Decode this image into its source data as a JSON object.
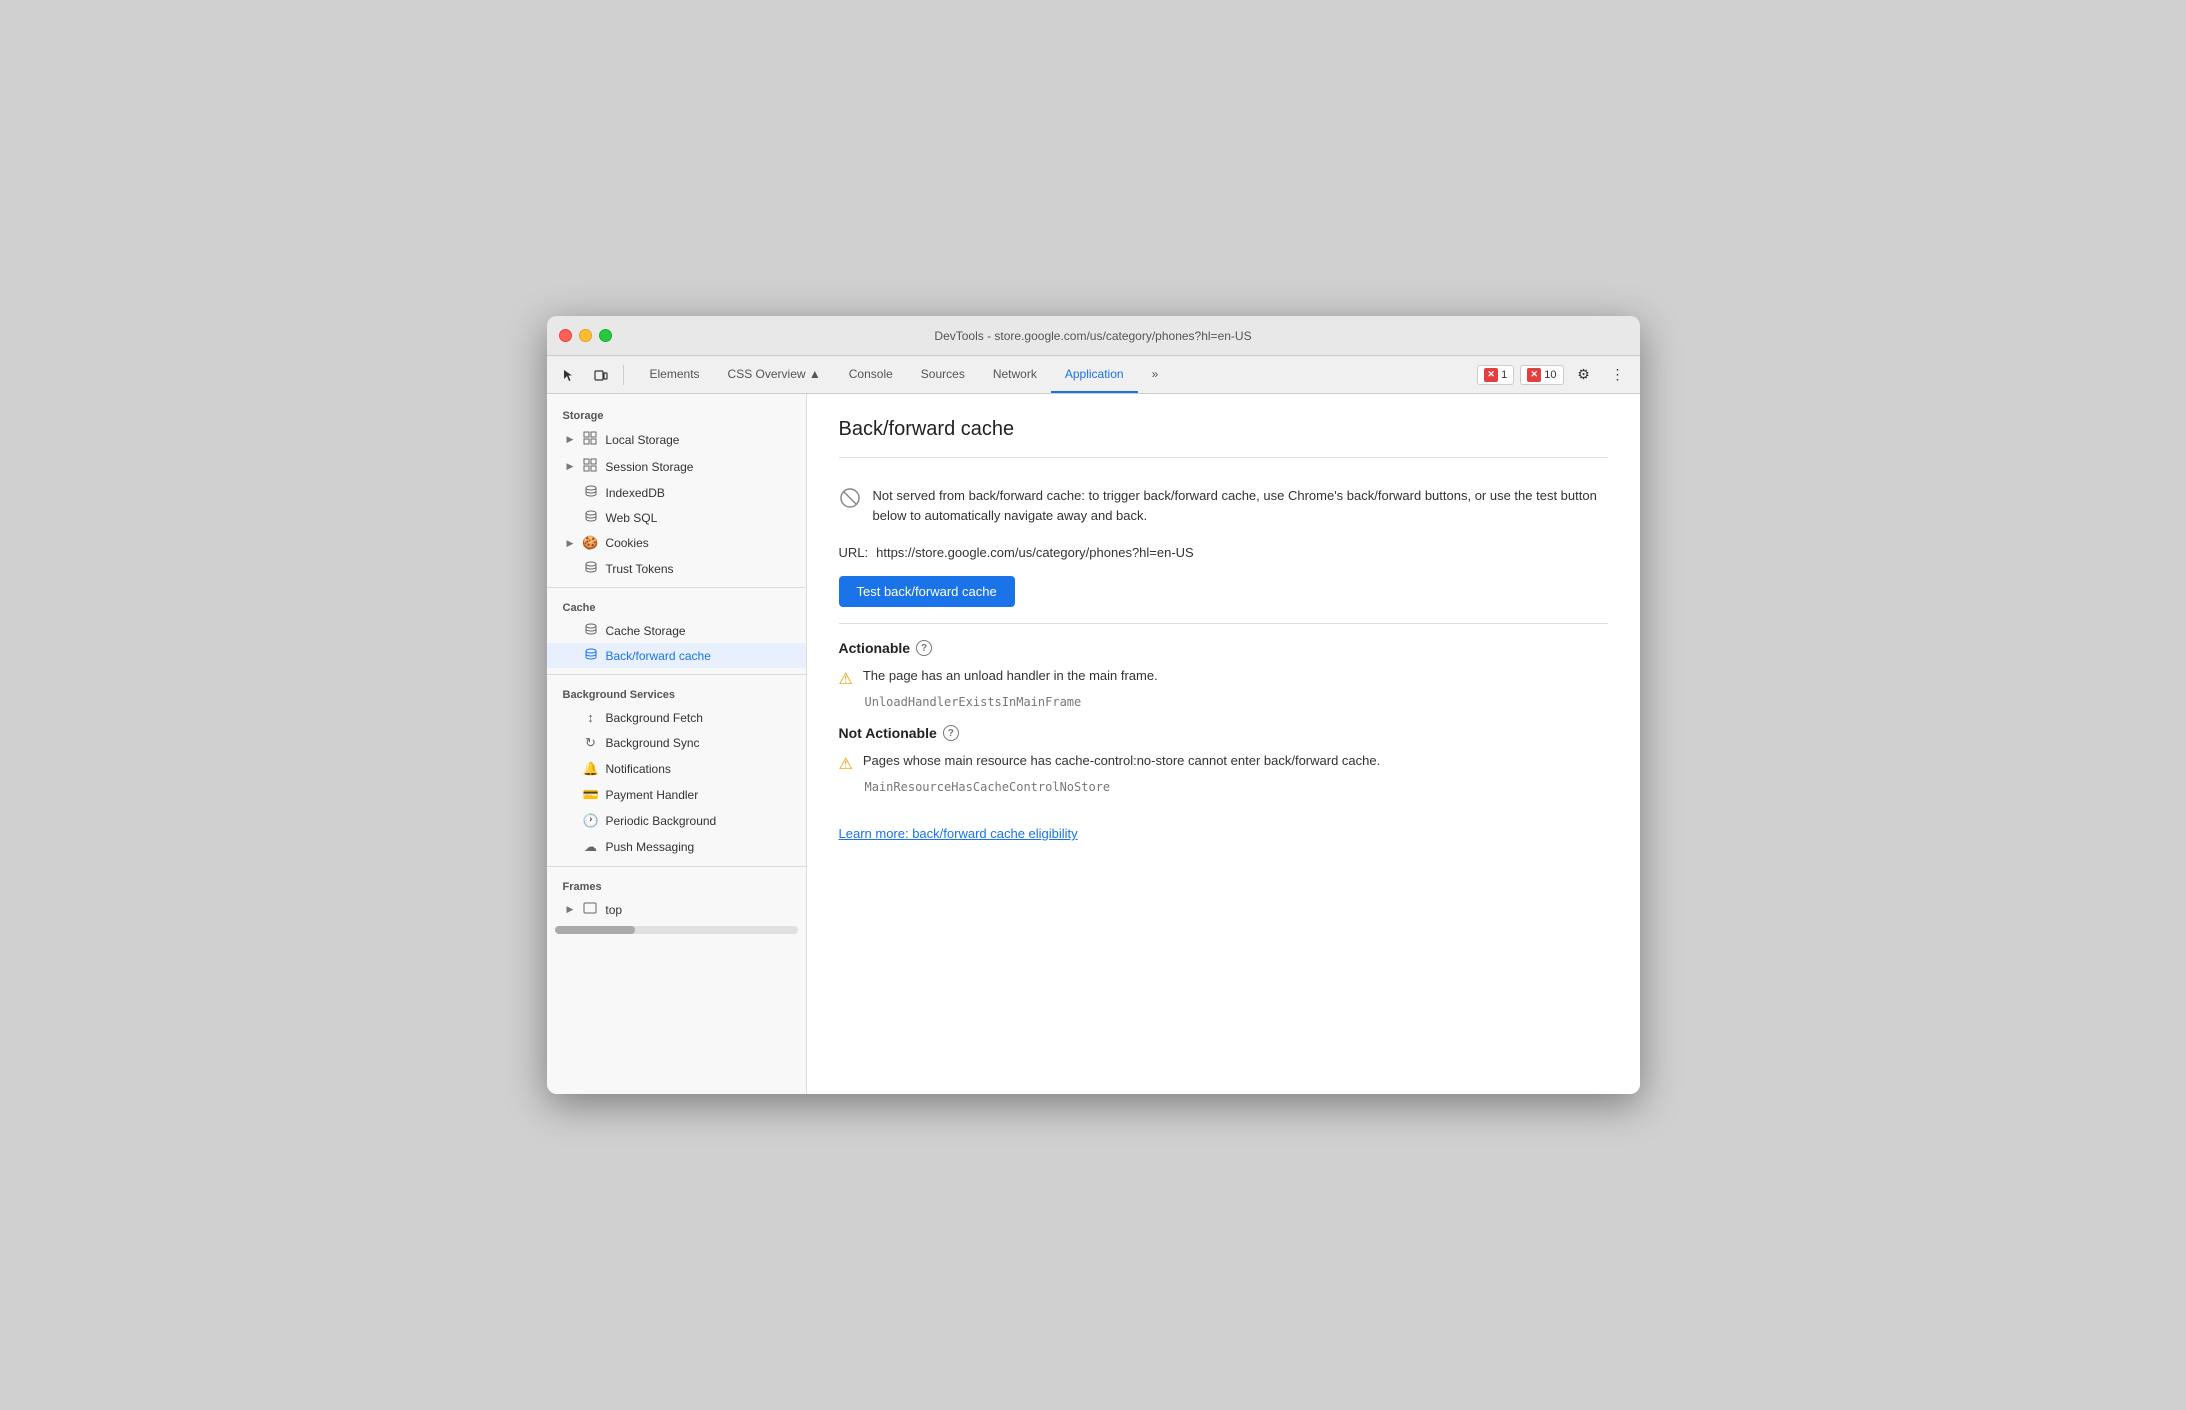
{
  "titlebar": {
    "title": "DevTools - store.google.com/us/category/phones?hl=en-US"
  },
  "toolbar": {
    "tabs": [
      {
        "label": "Elements",
        "active": false
      },
      {
        "label": "CSS Overview ▲",
        "active": false
      },
      {
        "label": "Console",
        "active": false
      },
      {
        "label": "Sources",
        "active": false
      },
      {
        "label": "Network",
        "active": false
      },
      {
        "label": "Application",
        "active": true
      },
      {
        "label": "»",
        "active": false
      }
    ],
    "errors": {
      "count": 1,
      "warnings": 10
    },
    "gear_label": "⚙",
    "more_label": "⋮"
  },
  "sidebar": {
    "storage_label": "Storage",
    "items": [
      {
        "id": "local-storage",
        "label": "Local Storage",
        "icon": "grid",
        "arrow": true
      },
      {
        "id": "session-storage",
        "label": "Session Storage",
        "icon": "grid",
        "arrow": true
      },
      {
        "id": "indexeddb",
        "label": "IndexedDB",
        "icon": "db"
      },
      {
        "id": "web-sql",
        "label": "Web SQL",
        "icon": "db"
      },
      {
        "id": "cookies",
        "label": "Cookies",
        "icon": "cookie",
        "arrow": true
      },
      {
        "id": "trust-tokens",
        "label": "Trust Tokens",
        "icon": "db"
      }
    ],
    "cache_label": "Cache",
    "cache_items": [
      {
        "id": "cache-storage",
        "label": "Cache Storage",
        "icon": "db"
      },
      {
        "id": "bf-cache",
        "label": "Back/forward cache",
        "icon": "db",
        "active": true
      }
    ],
    "bg_services_label": "Background Services",
    "bg_items": [
      {
        "id": "bg-fetch",
        "label": "Background Fetch",
        "icon": "arrows"
      },
      {
        "id": "bg-sync",
        "label": "Background Sync",
        "icon": "sync"
      },
      {
        "id": "notifications",
        "label": "Notifications",
        "icon": "bell"
      },
      {
        "id": "payment-handler",
        "label": "Payment Handler",
        "icon": "card"
      },
      {
        "id": "periodic-bg",
        "label": "Periodic Background",
        "icon": "clock"
      },
      {
        "id": "push-messaging",
        "label": "Push Messaging",
        "icon": "cloud"
      }
    ],
    "frames_label": "Frames",
    "frames_items": [
      {
        "id": "top",
        "label": "top",
        "icon": "frame",
        "arrow": true
      }
    ]
  },
  "main": {
    "title": "Back/forward cache",
    "info_message": "Not served from back/forward cache: to trigger back/forward cache, use Chrome's back/forward buttons, or use the test button below to automatically navigate away and back.",
    "url_label": "URL:",
    "url_value": "https://store.google.com/us/category/phones?hl=en-US",
    "test_button": "Test back/forward cache",
    "actionable_label": "Actionable",
    "actionable_warning": "The page has an unload handler in the main frame.",
    "actionable_code": "UnloadHandlerExistsInMainFrame",
    "not_actionable_label": "Not Actionable",
    "not_actionable_warning": "Pages whose main resource has cache-control:no-store cannot enter back/forward cache.",
    "not_actionable_code": "MainResourceHasCacheControlNoStore",
    "learn_more_link": "Learn more: back/forward cache eligibility"
  }
}
